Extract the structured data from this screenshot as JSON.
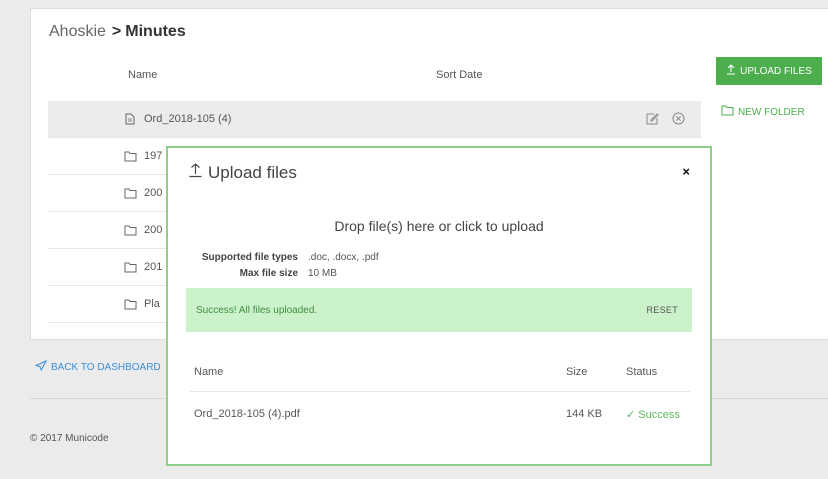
{
  "breadcrumb": {
    "parent": "Ahoskie",
    "separator": ">",
    "current": "Minutes"
  },
  "list": {
    "headers": {
      "name": "Name",
      "sort_date": "Sort Date"
    },
    "rows": [
      {
        "label": "Ord_2018-105 (4)",
        "type": "file"
      },
      {
        "label": "197",
        "type": "folder"
      },
      {
        "label": "200",
        "type": "folder"
      },
      {
        "label": "200",
        "type": "folder"
      },
      {
        "label": "201",
        "type": "folder"
      },
      {
        "label": "Pla",
        "type": "folder"
      }
    ]
  },
  "actions": {
    "upload_files": "UPLOAD FILES",
    "new_folder": "NEW FOLDER"
  },
  "footer": {
    "back": "BACK TO DASHBOARD",
    "copyright": "© 2017 Municode"
  },
  "modal": {
    "title": "Upload files",
    "close": "×",
    "dropzone": "Drop file(s) here or click to upload",
    "supported_label": "Supported file types",
    "supported_value": ".doc, .docx, .pdf",
    "max_label": "Max file size",
    "max_value": "10 MB",
    "success_message": "Success! All files uploaded.",
    "reset_label": "RESET",
    "table": {
      "headers": {
        "name": "Name",
        "size": "Size",
        "status": "Status"
      },
      "rows": [
        {
          "name": "Ord_2018-105 (4).pdf",
          "size": "144 KB",
          "status": "Success"
        }
      ]
    }
  },
  "colors": {
    "accent_green": "#4cae4c",
    "success_bg": "#ccf2cc",
    "link_blue": "#3a8fd6",
    "modal_border": "#8dd08d"
  }
}
